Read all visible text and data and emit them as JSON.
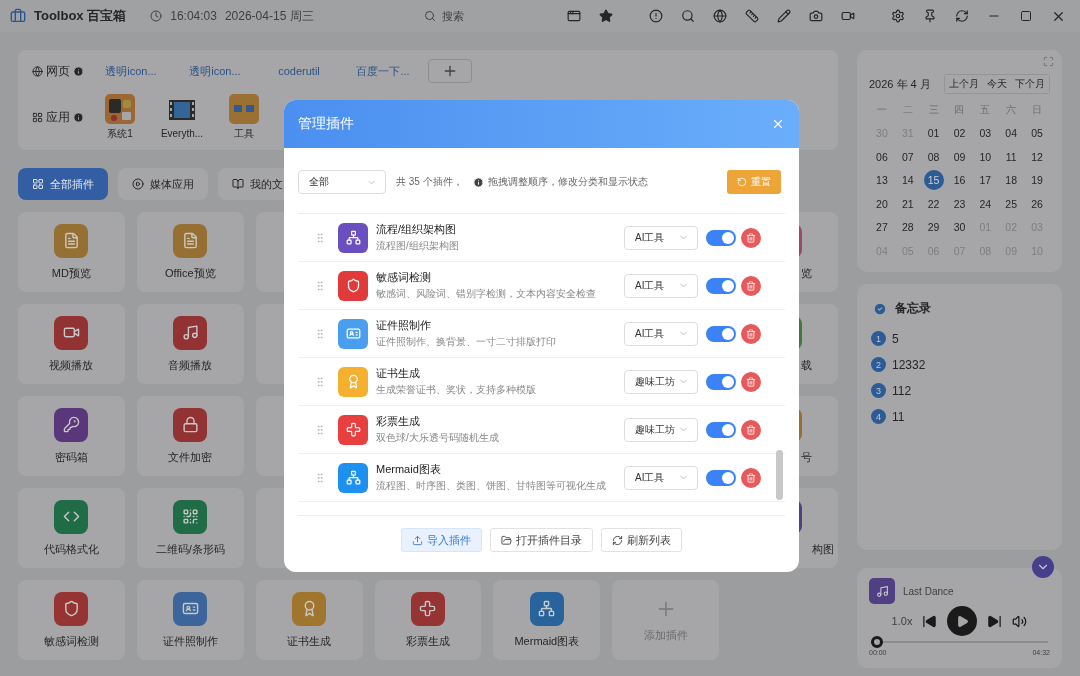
{
  "app": {
    "title": "Toolbox 百宝箱",
    "time": "16:04:03",
    "date": "2026-04-15 周三",
    "search_placeholder": "搜索"
  },
  "quick": {
    "web_label": "网页",
    "links": [
      "透明icon...",
      "透明icon...",
      "coderutil",
      "百度一下..."
    ],
    "app_label": "应用",
    "apps": [
      {
        "label": "系统1",
        "kind": "system"
      },
      {
        "label": "Everyth...",
        "kind": "film"
      },
      {
        "label": "工具",
        "kind": "tool"
      }
    ]
  },
  "categories": [
    {
      "label": "全部插件",
      "kind": "grid",
      "selected": true
    },
    {
      "label": "媒体应用",
      "kind": "play",
      "selected": false
    },
    {
      "label": "我的文",
      "kind": "doc",
      "selected": false
    }
  ],
  "plugin_grid": {
    "rows": [
      {
        "left": [
          {
            "label": "MD预览",
            "kind": "file",
            "color": "#967033"
          },
          {
            "label": "Office预览",
            "kind": "file",
            "color": "#967033"
          }
        ],
        "right": {
          "label": "览",
          "color": "#9b4a64"
        }
      },
      {
        "left": [
          {
            "label": "视频播放",
            "kind": "video",
            "color": "#923233"
          },
          {
            "label": "音频播放",
            "kind": "music",
            "color": "#923233"
          }
        ],
        "right": {
          "label": "载",
          "color": "#3e7940"
        }
      },
      {
        "left": [
          {
            "label": "密码箱",
            "kind": "key",
            "color": "#5a367a"
          },
          {
            "label": "文件加密",
            "kind": "lock",
            "color": "#923233"
          }
        ],
        "right": {
          "label": "号",
          "color": "#967033"
        }
      },
      {
        "left": [
          {
            "label": "代码格式化",
            "kind": "code",
            "color": "#206c46"
          },
          {
            "label": "二维码/条形码",
            "kind": "qr",
            "color": "#206c46"
          }
        ],
        "right": {
          "label": "构图",
          "color": "#503f83"
        }
      }
    ],
    "bottom": [
      {
        "label": "敏感词检测",
        "kind": "shield",
        "color": "#963333"
      },
      {
        "label": "证件照制作",
        "kind": "idcard",
        "color": "#3c669b"
      },
      {
        "label": "证书生成",
        "kind": "award",
        "color": "#a0752d"
      },
      {
        "label": "彩票生成",
        "kind": "cross",
        "color": "#963333"
      },
      {
        "label": "Mermaid图表",
        "kind": "network",
        "color": "#29639b"
      },
      {
        "label": "添加插件",
        "kind": "add",
        "color": "#808080"
      }
    ]
  },
  "calendar": {
    "heading": "2026 年 4 月",
    "buttons": [
      "上个月",
      "今天",
      "下个月"
    ],
    "weekdays": [
      "一",
      "二",
      "三",
      "四",
      "五",
      "六",
      "日"
    ],
    "weeks": [
      [
        {
          "d": "30",
          "muted": true,
          "selected": false
        },
        {
          "d": "31",
          "muted": true,
          "selected": false
        },
        {
          "d": "01",
          "muted": false,
          "selected": false
        },
        {
          "d": "02",
          "muted": false,
          "selected": false
        },
        {
          "d": "03",
          "muted": false,
          "selected": false
        },
        {
          "d": "04",
          "muted": false,
          "selected": false
        },
        {
          "d": "05",
          "muted": false,
          "selected": false
        }
      ],
      [
        {
          "d": "06",
          "muted": false,
          "selected": false
        },
        {
          "d": "07",
          "muted": false,
          "selected": false
        },
        {
          "d": "08",
          "muted": false,
          "selected": false
        },
        {
          "d": "09",
          "muted": false,
          "selected": false
        },
        {
          "d": "10",
          "muted": false,
          "selected": false
        },
        {
          "d": "11",
          "muted": false,
          "selected": false
        },
        {
          "d": "12",
          "muted": false,
          "selected": false
        }
      ],
      [
        {
          "d": "13",
          "muted": false,
          "selected": false
        },
        {
          "d": "14",
          "muted": false,
          "selected": false
        },
        {
          "d": "15",
          "muted": false,
          "selected": true
        },
        {
          "d": "16",
          "muted": false,
          "selected": false
        },
        {
          "d": "17",
          "muted": false,
          "selected": false
        },
        {
          "d": "18",
          "muted": false,
          "selected": false
        },
        {
          "d": "19",
          "muted": false,
          "selected": false
        }
      ],
      [
        {
          "d": "20",
          "muted": false,
          "selected": false
        },
        {
          "d": "21",
          "muted": false,
          "selected": false
        },
        {
          "d": "22",
          "muted": false,
          "selected": false
        },
        {
          "d": "23",
          "muted": false,
          "selected": false
        },
        {
          "d": "24",
          "muted": false,
          "selected": false
        },
        {
          "d": "25",
          "muted": false,
          "selected": false
        },
        {
          "d": "26",
          "muted": false,
          "selected": false
        }
      ],
      [
        {
          "d": "27",
          "muted": false,
          "selected": false
        },
        {
          "d": "28",
          "muted": false,
          "selected": false
        },
        {
          "d": "29",
          "muted": false,
          "selected": false
        },
        {
          "d": "30",
          "muted": false,
          "selected": false
        },
        {
          "d": "01",
          "muted": true,
          "selected": false
        },
        {
          "d": "02",
          "muted": true,
          "selected": false
        },
        {
          "d": "03",
          "muted": true,
          "selected": false
        }
      ],
      [
        {
          "d": "04",
          "muted": true,
          "selected": false
        },
        {
          "d": "05",
          "muted": true,
          "selected": false
        },
        {
          "d": "06",
          "muted": true,
          "selected": false
        },
        {
          "d": "07",
          "muted": true,
          "selected": false
        },
        {
          "d": "08",
          "muted": true,
          "selected": false
        },
        {
          "d": "09",
          "muted": true,
          "selected": false
        },
        {
          "d": "10",
          "muted": true,
          "selected": false
        }
      ]
    ]
  },
  "memo": {
    "title": "备忘录",
    "items": [
      {
        "num": "1",
        "text": "5"
      },
      {
        "num": "2",
        "text": "12332"
      },
      {
        "num": "3",
        "text": "112"
      },
      {
        "num": "4",
        "text": "11"
      }
    ]
  },
  "player": {
    "title": "Last Dance",
    "speed": "1.0x",
    "level": 0,
    "elapsed": "00:00",
    "total": "04:32"
  },
  "modal": {
    "title": "管理插件",
    "filter": "全部",
    "count": "共 35 个插件，",
    "hint": "拖拽调整顺序，修改分类和显示状态",
    "reset": "重置",
    "plugins": [
      {
        "name": "流程/组织架构图",
        "desc": "流程图/组织架构图",
        "category": "AI工具",
        "enabled": true,
        "kind": "network",
        "color": "#6a4fc0"
      },
      {
        "name": "敏感词检测",
        "desc": "敏感词、风险词、错别字检测，文本内容安全检查",
        "category": "AI工具",
        "enabled": true,
        "kind": "shield",
        "color": "#e03a3a"
      },
      {
        "name": "证件照制作",
        "desc": "证件照制作、换背景、一寸二寸排版打印",
        "category": "AI工具",
        "enabled": true,
        "kind": "idcard",
        "color": "#4a9ef0"
      },
      {
        "name": "证书生成",
        "desc": "生成荣誉证书、奖状，支持多种模版",
        "category": "趣味工坊",
        "enabled": true,
        "kind": "award",
        "color": "#f5b030"
      },
      {
        "name": "彩票生成",
        "desc": "双色球/大乐透号码随机生成",
        "category": "趣味工坊",
        "enabled": true,
        "kind": "cross",
        "color": "#e8403e"
      },
      {
        "name": "Mermaid图表",
        "desc": "流程图、时序图、类图、饼图、甘特图等可视化生成",
        "category": "AI工具",
        "enabled": true,
        "kind": "network",
        "color": "#1e90f0"
      }
    ],
    "buttons": [
      {
        "label": "导入插件",
        "kind": "import"
      },
      {
        "label": "打开插件目录",
        "kind": "folder"
      },
      {
        "label": "刷新列表",
        "kind": "refresh"
      }
    ]
  }
}
